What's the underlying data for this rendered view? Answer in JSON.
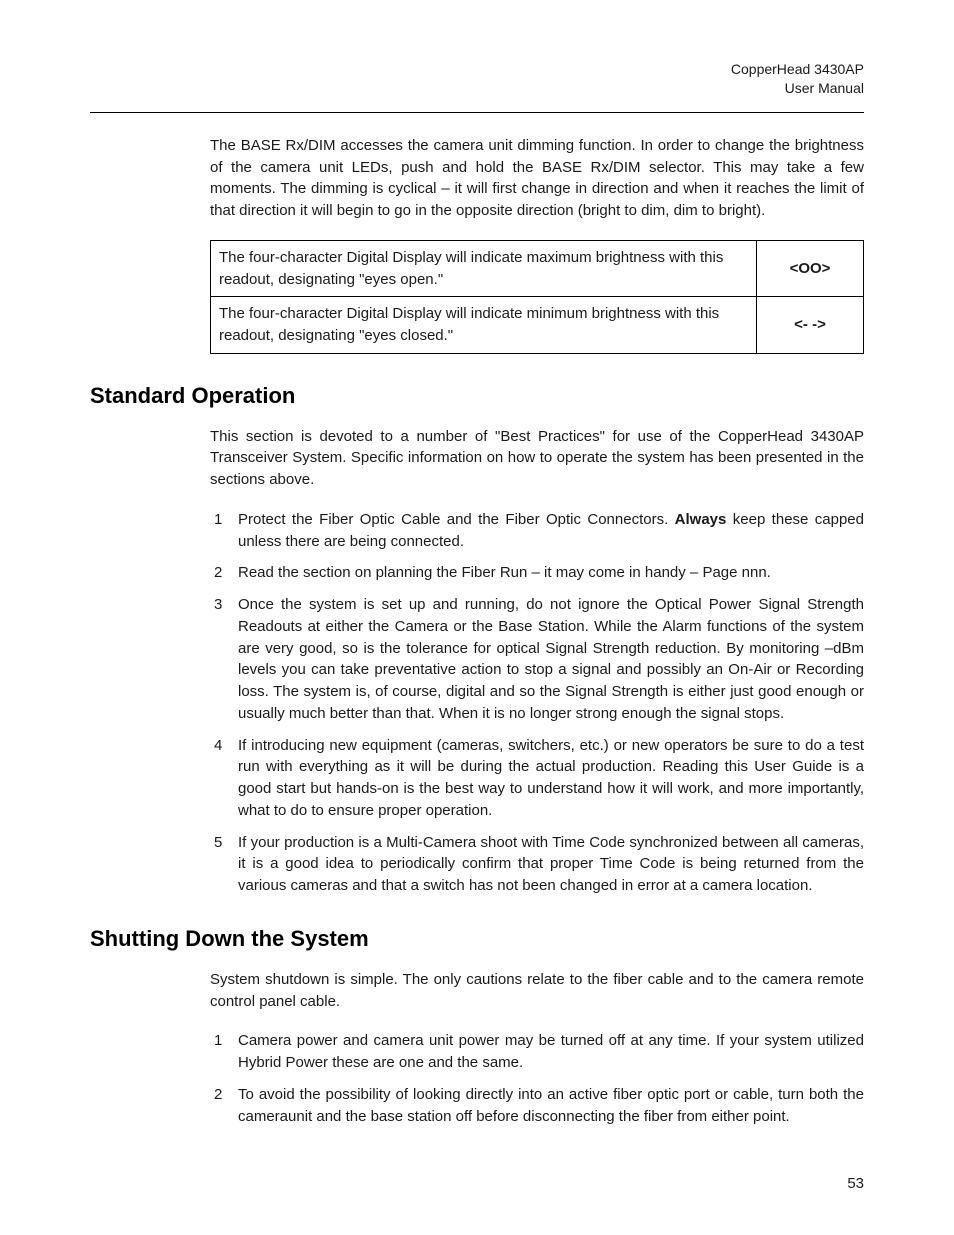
{
  "header": {
    "product": "CopperHead 3430AP",
    "doc": "User Manual"
  },
  "intro_para": "The BASE Rx/DIM accesses the camera unit dimming function.  In order to change the brightness of the camera unit LEDs, push and hold the BASE Rx/DIM selector. This may take a few moments. The dimming is cyclical – it will first change in direction and when it reaches the limit of that direction it will begin to go in the opposite direction (bright to dim, dim to bright).",
  "display_table": {
    "rows": [
      {
        "desc": "The four-character Digital Display will indicate maximum brightness with this readout, designating \"eyes open.\"",
        "symbol": "<OO>"
      },
      {
        "desc": "The four-character Digital Display will indicate minimum brightness with this readout, designating \"eyes closed.\"",
        "symbol": "<- ->"
      }
    ]
  },
  "section1": {
    "title": "Standard Operation",
    "intro": "This section is devoted to a number of \"Best Practices\" for use of the CopperHead 3430AP Transceiver System.  Specific information on how to operate the system has been presented in the sections above.",
    "items": [
      {
        "pre": "Protect the Fiber Optic Cable and the Fiber Optic Connectors.  ",
        "bold": "Always",
        "post": " keep these capped unless there are being connected."
      },
      {
        "pre": "Read the section on planning the Fiber Run – it may come in handy – Page nnn.",
        "bold": "",
        "post": ""
      },
      {
        "pre": "Once the system is set up and running, do not ignore the Optical Power Signal Strength Readouts at either the Camera or the Base Station.  While the Alarm functions of the system are very good, so is the tolerance for optical Signal Strength reduction.  By monitoring –dBm levels you can take preventative action to stop a signal and possibly an On-Air or Recording loss.  The system is, of course, digital and so the Signal Strength is either just good enough or usually much better than that. When it is no longer strong enough the signal stops.",
        "bold": "",
        "post": ""
      },
      {
        "pre": "If introducing new equipment (cameras, switchers, etc.) or new operators be sure to do a test run with everything as it will be during the actual production.  Reading this User Guide is a good start but hands-on is the best way to understand how it will work, and more importantly, what to do to ensure proper operation.",
        "bold": "",
        "post": ""
      },
      {
        "pre": "If your production is a Multi-Camera shoot with Time Code synchronized between all cameras, it is a good idea to periodically confirm that proper Time Code is being returned from the various cameras and that a switch has not been changed in error at a camera location.",
        "bold": "",
        "post": ""
      }
    ]
  },
  "section2": {
    "title": "Shutting Down the System",
    "intro": "System shutdown is simple. The only cautions relate to the fiber cable and to the camera remote control panel cable.",
    "items": [
      {
        "pre": "Camera power and camera unit power may be turned off at any time. If your system utilized Hybrid Power these are one and the same.",
        "bold": "",
        "post": ""
      },
      {
        "pre": "To avoid the possibility of looking directly into an active fiber optic port or cable, turn both the cameraunit and the base station off before disconnecting the fiber from either point.",
        "bold": "",
        "post": ""
      }
    ]
  },
  "page_number": "53"
}
